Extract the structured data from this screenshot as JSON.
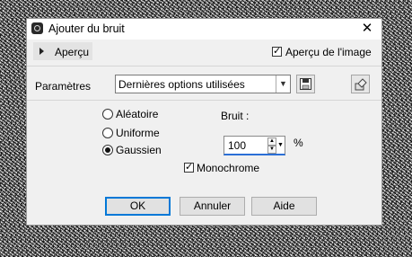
{
  "window": {
    "title": "Ajouter du bruit",
    "close_glyph": "✕",
    "app_icon": "camera-icon"
  },
  "preview": {
    "toggle_label": "Aperçu",
    "image_preview_label": "Aperçu de l'image",
    "image_preview_checked": true
  },
  "params": {
    "label": "Paramètres",
    "preset_value": "Dernières options utilisées",
    "save_icon": "save-icon",
    "load_icon": "preset-manager-icon"
  },
  "noise_type": {
    "options": [
      {
        "label": "Aléatoire",
        "selected": false
      },
      {
        "label": "Uniforme",
        "selected": false
      },
      {
        "label": "Gaussien",
        "selected": true
      }
    ]
  },
  "noise": {
    "label": "Bruit :",
    "value": "100",
    "unit": "%"
  },
  "monochrome": {
    "label": "Monochrome",
    "checked": true
  },
  "buttons": {
    "ok": "OK",
    "cancel": "Annuler",
    "help": "Aide"
  },
  "colors": {
    "accent": "#0078d7",
    "dialog_bg": "#f0f0f0"
  }
}
